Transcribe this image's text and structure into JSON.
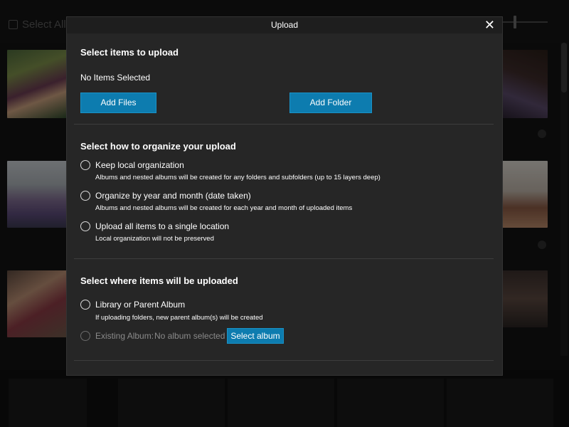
{
  "background": {
    "select_all_label": "Select All"
  },
  "dialog": {
    "title": "Upload",
    "close_glyph": "✕",
    "section_items": {
      "title": "Select items to upload",
      "status": "No Items Selected",
      "add_files_label": "Add Files",
      "add_folder_label": "Add Folder"
    },
    "section_organize": {
      "title": "Select how to organize your upload",
      "options": [
        {
          "label": "Keep local organization",
          "description": "Albums and nested albums will be created for any folders and subfolders (up to 15 layers deep)"
        },
        {
          "label": "Organize by year and month (date taken)",
          "description": "Albums and nested albums will be created for each year and month of uploaded items"
        },
        {
          "label": "Upload all items to a single location",
          "description": "Local organization will not be preserved"
        }
      ]
    },
    "section_destination": {
      "title": "Select where items will be uploaded",
      "library_label": "Library or Parent Album",
      "library_description": "If uploading folders, new parent album(s) will be created",
      "existing_label": "Existing Album:",
      "existing_value": "No album selected",
      "select_album_label": "Select album"
    }
  }
}
